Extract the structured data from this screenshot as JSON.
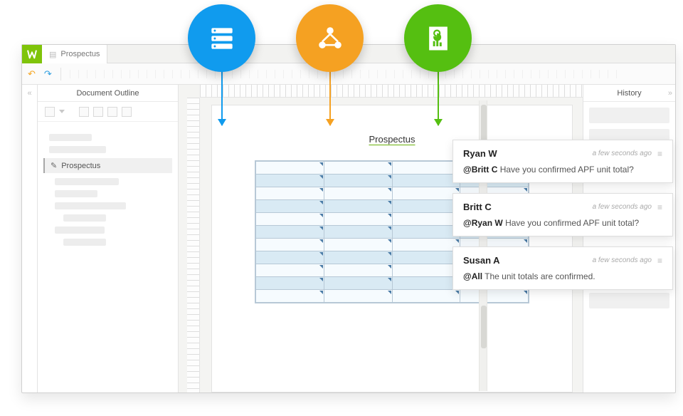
{
  "tab": {
    "title": "Prospectus"
  },
  "outline": {
    "title": "Document Outline",
    "active_item": "Prospectus"
  },
  "document": {
    "title": "Prospectus"
  },
  "history": {
    "title": "History"
  },
  "features": {
    "blue": "data-icon",
    "orange": "collaboration-icon",
    "green": "report-icon"
  },
  "comments": [
    {
      "user": "Ryan W",
      "time": "a few seconds ago",
      "mention": "@Britt C",
      "text": "Have you confirmed APF unit total?"
    },
    {
      "user": "Britt C",
      "time": "a few seconds ago",
      "mention": "@Ryan W",
      "text": "Have you confirmed APF unit total?"
    },
    {
      "user": "Susan A",
      "time": "a few seconds ago",
      "mention": "@All",
      "text": "The unit totals are confirmed."
    }
  ]
}
